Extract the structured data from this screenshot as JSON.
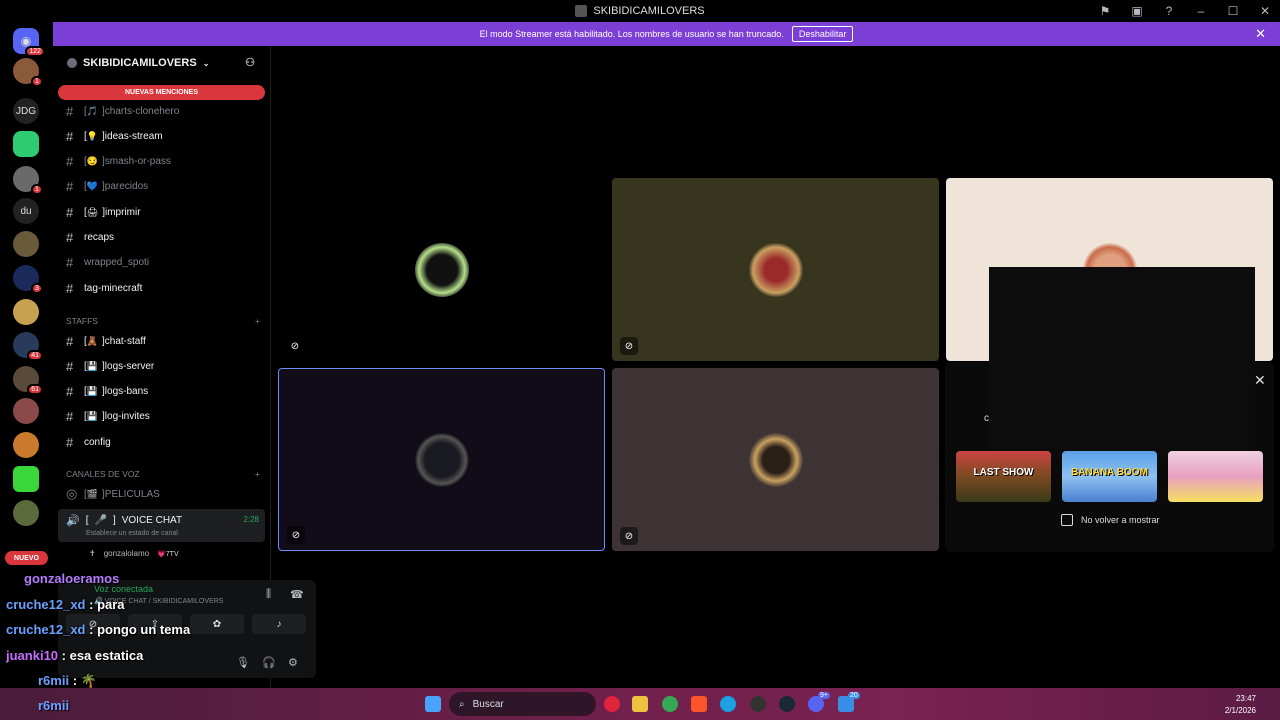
{
  "window": {
    "title": "SKIBIDICAMILOVERS"
  },
  "banner": {
    "message": "El modo Streamer está habilitado. Los nombres de usuario se han truncado.",
    "button_label": "Deshabilitar"
  },
  "rail": {
    "top_badge": "122",
    "servers": [
      {
        "label": "",
        "badge": "1"
      },
      {
        "label": "JDG",
        "badge": ""
      },
      {
        "label": "",
        "badge": ""
      },
      {
        "label": "",
        "badge": "1"
      },
      {
        "label": "du",
        "badge": ""
      },
      {
        "label": "",
        "badge": ""
      },
      {
        "label": "",
        "badge": "3"
      },
      {
        "label": "",
        "badge": ""
      },
      {
        "label": "",
        "badge": "41"
      },
      {
        "label": "",
        "badge": "61"
      },
      {
        "label": "",
        "badge": ""
      },
      {
        "label": "",
        "badge": ""
      },
      {
        "label": "",
        "badge": ""
      },
      {
        "label": "",
        "badge": ""
      }
    ],
    "new_label": "NUEVO"
  },
  "sidebar": {
    "guild_name": "SKIBIDICAMILOVERS",
    "mentions_label": "NUEVAS MENCIONES",
    "channels": [
      {
        "emoji": "🎵",
        "name": "charts-clonehero",
        "bracket": true
      },
      {
        "emoji": "💡",
        "name": "ideas-stream",
        "bracket": true
      },
      {
        "emoji": "😏",
        "name": "smash-or-pass",
        "bracket": true
      },
      {
        "emoji": "💙",
        "name": "parecidos",
        "bracket": true
      },
      {
        "emoji": "🖨",
        "name": "imprimir",
        "bracket": true
      },
      {
        "emoji": "",
        "name": "recaps",
        "bracket": false
      },
      {
        "emoji": "",
        "name": "wrapped_spoti",
        "bracket": false
      },
      {
        "emoji": "",
        "name": "tag-minecraft",
        "bracket": false
      }
    ],
    "staff_category": "STAFFS",
    "staff_channels": [
      {
        "emoji": "🧸",
        "name": "chat-staff",
        "bracket": true
      },
      {
        "emoji": "💾",
        "name": "logs-server",
        "bracket": true
      },
      {
        "emoji": "💾",
        "name": "logs-bans",
        "bracket": true
      },
      {
        "emoji": "💾",
        "name": "log-invites",
        "bracket": true
      },
      {
        "emoji": "",
        "name": "config",
        "bracket": false
      }
    ],
    "voice_category": "CANALES DE VOZ",
    "voice_channels": [
      {
        "emoji": "🎬",
        "name": "PELICULAS"
      }
    ],
    "active_voice": {
      "emoji": "🎤",
      "name": "VOICE CHAT",
      "timer": "2:28",
      "status": "Establece un estado de canal"
    },
    "voice_user": {
      "name": "gonzalolamo",
      "tag": "💗7TV"
    }
  },
  "voice_panel": {
    "connected": "Voz conectada",
    "location": "🔊 VOICE CHAT / SKIBIDICAMILOVERS"
  },
  "chat_overlay": [
    {
      "user": "gonzaloeramos",
      "text": ""
    },
    {
      "user": "cruche12_xd",
      "text": "para"
    },
    {
      "user": "cruche12_xd",
      "text": "pongo un tema"
    },
    {
      "user": "juanki10",
      "text": "esa estatica"
    },
    {
      "user": "r6mii",
      "text": "🌴"
    }
  ],
  "popup": {
    "letter": "c",
    "games": [
      {
        "label": "LAST SHOW"
      },
      {
        "label": "BANANA BOOM"
      },
      {
        "label": ""
      }
    ],
    "checkbox_label": "No volver a mostrar"
  },
  "taskbar": {
    "user": "r6mii",
    "search_placeholder": "Buscar",
    "discord_badge": "9+",
    "app_badge": "20",
    "time": "23:47",
    "date": "2/1/2026"
  },
  "colors": {
    "accent": "#7c3fd6",
    "mention_red": "#da373c",
    "voice_green": "#23a55a"
  }
}
